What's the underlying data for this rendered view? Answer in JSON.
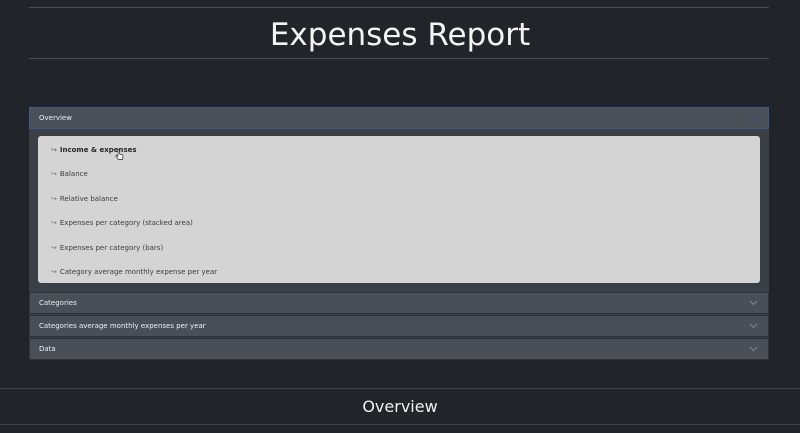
{
  "header": {
    "title": "Expenses Report"
  },
  "accordion": {
    "overview": {
      "label": "Overview",
      "items": [
        {
          "label": "Income & expenses"
        },
        {
          "label": "Balance"
        },
        {
          "label": "Relative balance"
        },
        {
          "label": "Expenses per category (stacked area)"
        },
        {
          "label": "Expenses per category (bars)"
        },
        {
          "label": "Category average monthly expense per year"
        }
      ]
    },
    "categories": {
      "label": "Categories"
    },
    "categories_avg": {
      "label": "Categories average monthly expenses per year"
    },
    "data": {
      "label": "Data"
    }
  },
  "section": {
    "title": "Overview"
  },
  "icons": {
    "chevron": "chevron-down-icon",
    "subitem": "return-arrow-icon",
    "cursor": "hand-pointer-icon"
  },
  "colors": {
    "background": "#212429",
    "panel": "#d4d4d4",
    "header_row": "#494e57"
  }
}
